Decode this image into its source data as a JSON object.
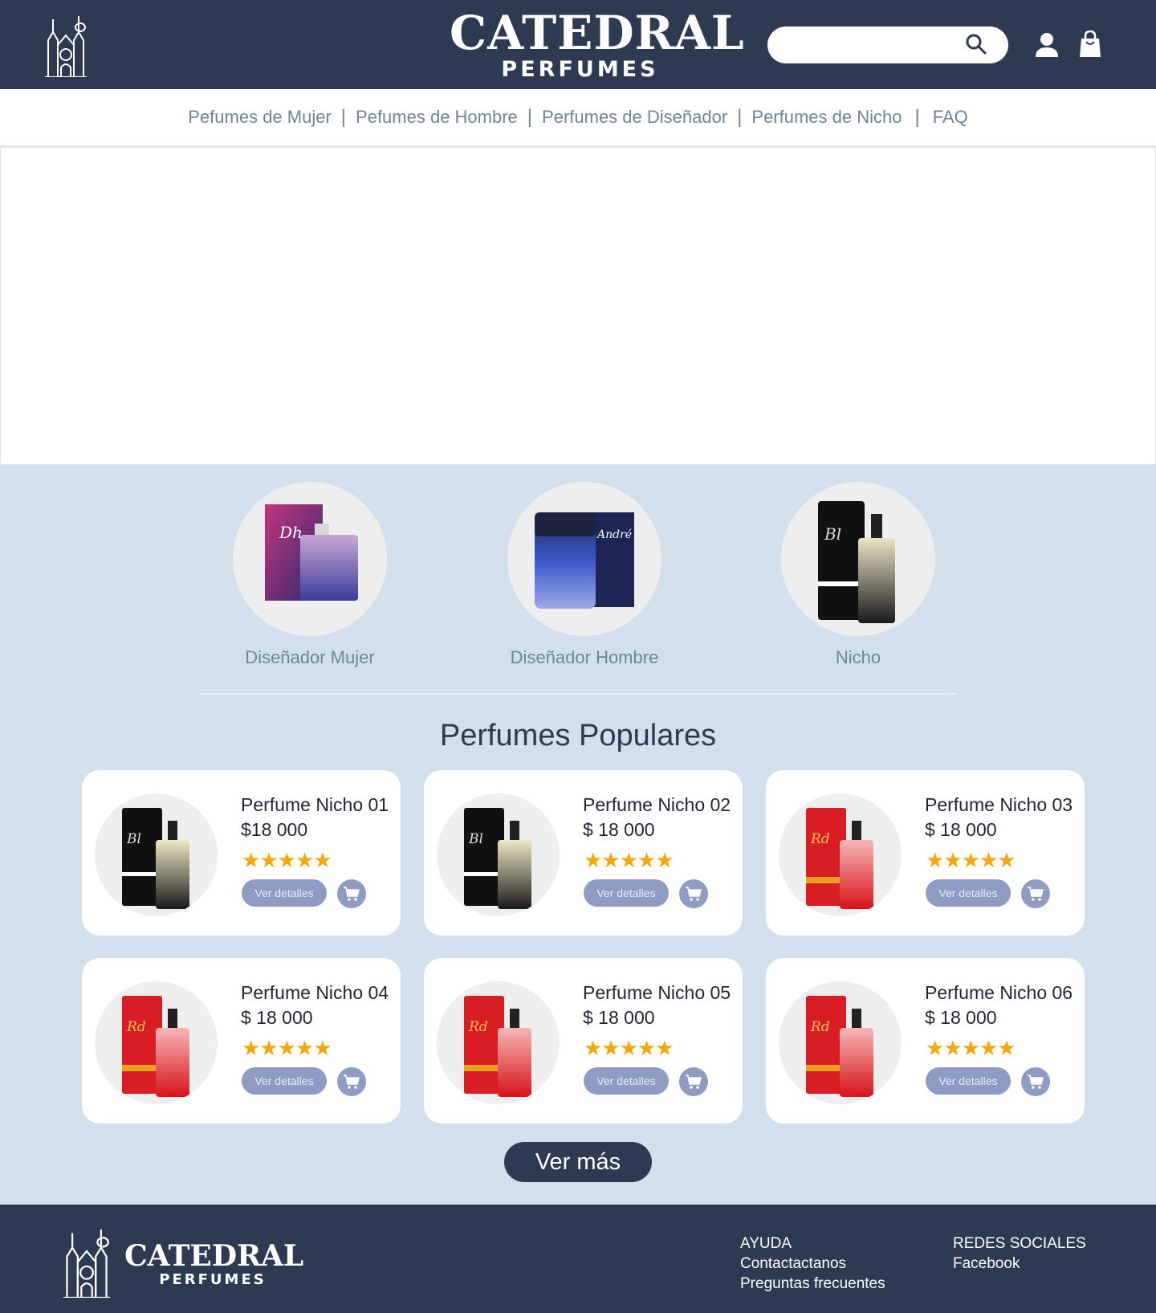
{
  "header": {
    "brand_name": "CATEDRAL",
    "brand_sub": "PERFUMES",
    "search_placeholder": ""
  },
  "nav": {
    "items": [
      {
        "label": "Pefumes de Mujer"
      },
      {
        "label": "Pefumes de Hombre"
      },
      {
        "label": "Perfumes de Diseñador"
      },
      {
        "label": "Perfumes de Nicho"
      },
      {
        "label": "FAQ"
      }
    ],
    "separator": "|"
  },
  "categories": [
    {
      "label": "Diseñador Mujer",
      "image": "designer-women-perfume"
    },
    {
      "label": "Diseñador Hombre",
      "image": "designer-men-perfume"
    },
    {
      "label": "Nicho",
      "image": "niche-perfume"
    }
  ],
  "popular": {
    "title": "Perfumes Populares",
    "products": [
      {
        "name": "Perfume Nicho 01",
        "price": "$18 000",
        "stars": "★★★★★",
        "rating": 5,
        "details_label": "Ver detalles",
        "variant": "black"
      },
      {
        "name": "Perfume Nicho 02",
        "price": "$ 18 000",
        "stars": "★★★★★",
        "rating": 5,
        "details_label": "Ver detalles",
        "variant": "black"
      },
      {
        "name": "Perfume Nicho 03",
        "price": "$ 18 000",
        "stars": "★★★★★",
        "rating": 5,
        "details_label": "Ver detalles",
        "variant": "red"
      },
      {
        "name": "Perfume Nicho 04",
        "price": "$ 18 000",
        "stars": "★★★★★",
        "rating": 5,
        "details_label": "Ver detalles",
        "variant": "red"
      },
      {
        "name": "Perfume Nicho 05",
        "price": "$ 18 000",
        "stars": "★★★★★",
        "rating": 5,
        "details_label": "Ver detalles",
        "variant": "red"
      },
      {
        "name": "Perfume Nicho 06",
        "price": "$ 18 000",
        "stars": "★★★★★",
        "rating": 5,
        "details_label": "Ver detalles",
        "variant": "red"
      }
    ],
    "more_label": "Ver más"
  },
  "footer": {
    "brand_name": "CATEDRAL",
    "brand_sub": "PERFUMES",
    "help": {
      "heading": "AYUDA",
      "links": [
        "Contactactanos",
        "Preguntas frecuentes"
      ]
    },
    "social": {
      "heading": "REDES SOCIALES",
      "links": [
        "Facebook"
      ]
    }
  },
  "colors": {
    "header_bg": "#2d3a52",
    "main_bg": "#d1e0ec",
    "nav_text": "#6f8596",
    "button": "#8e9cc3",
    "star": "#f5a70a"
  }
}
